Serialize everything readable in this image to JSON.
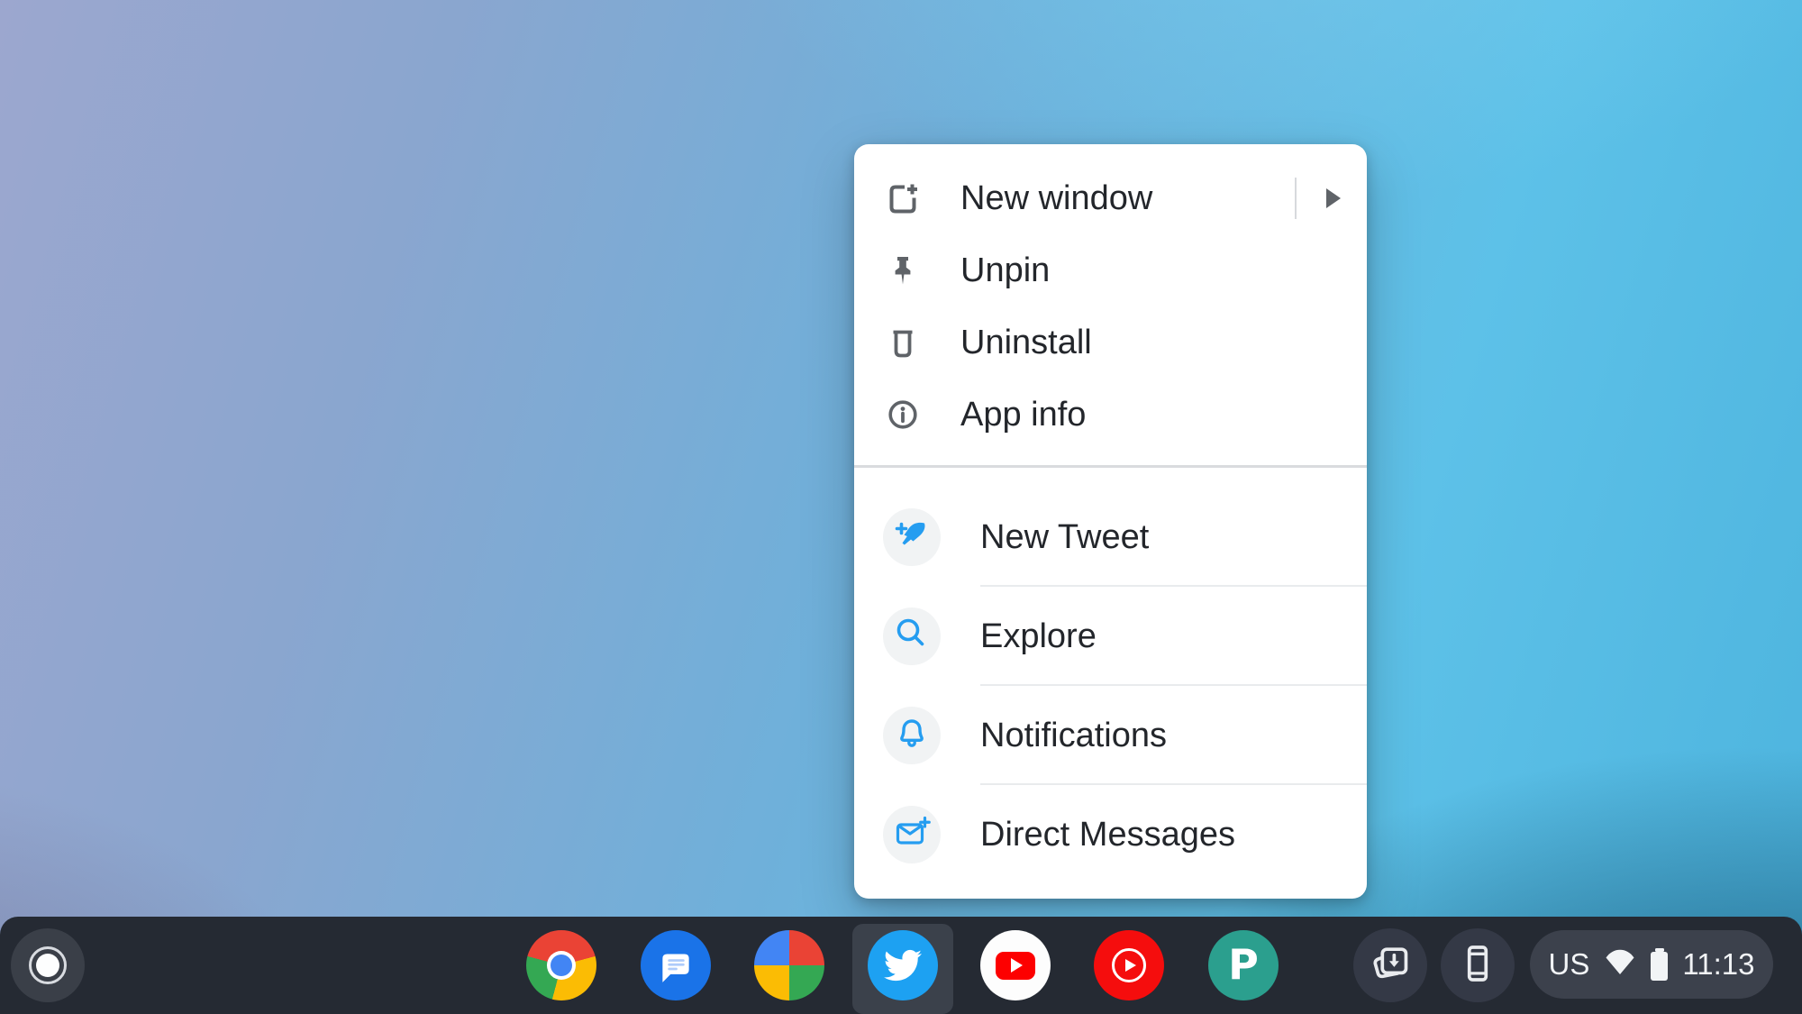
{
  "context_menu": {
    "items": [
      {
        "label": "New window",
        "icon": "new-window-icon",
        "has_submenu": true
      },
      {
        "label": "Unpin",
        "icon": "pin-icon",
        "has_submenu": false
      },
      {
        "label": "Uninstall",
        "icon": "trash-icon",
        "has_submenu": false
      },
      {
        "label": "App info",
        "icon": "info-icon",
        "has_submenu": false
      }
    ],
    "shortcuts": [
      {
        "label": "New Tweet",
        "icon": "compose-tweet-icon"
      },
      {
        "label": "Explore",
        "icon": "search-icon"
      },
      {
        "label": "Notifications",
        "icon": "bell-icon"
      },
      {
        "label": "Direct Messages",
        "icon": "envelope-plus-icon"
      }
    ]
  },
  "shelf": {
    "apps": [
      {
        "name": "Chrome"
      },
      {
        "name": "Messages"
      },
      {
        "name": "Google"
      },
      {
        "name": "Twitter",
        "active": true
      },
      {
        "name": "YouTube"
      },
      {
        "name": "YouTube Music"
      },
      {
        "name": "Pocket Casts",
        "letter": "P"
      }
    ],
    "status": {
      "keyboard_layout": "US",
      "time": "11:13"
    }
  },
  "colors": {
    "menu_icon_gray": "#5f6368",
    "shortcut_blue": "#259df0",
    "shelf_dark": "#252a33",
    "active_tile": "#3b414b",
    "twitter_blue": "#1da1f2",
    "messages_blue": "#1a73e8",
    "youtube_red": "#fd0000",
    "pocket_casts_teal": "#2b9f8e"
  }
}
